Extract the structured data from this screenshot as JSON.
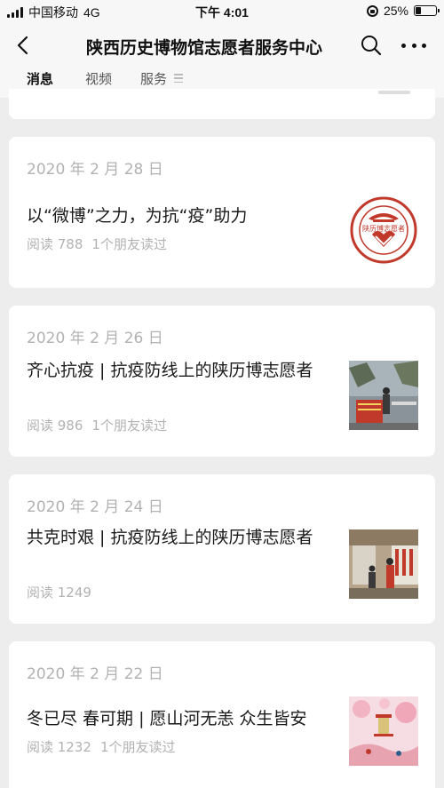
{
  "status_bar": {
    "carrier": "中国移动",
    "network": "4G",
    "time": "下午 4:01",
    "battery": "25%",
    "battery_level": 0.25
  },
  "nav": {
    "title": "陕西历史博物馆志愿者服务中心",
    "icons": [
      "back-icon",
      "search-icon",
      "more-icon"
    ]
  },
  "tabs": [
    {
      "label": "消息",
      "active": true
    },
    {
      "label": "视频",
      "active": false
    },
    {
      "label": "服务",
      "active": false
    }
  ],
  "colors": {
    "background": "#ededed",
    "card": "#ffffff",
    "muted_text": "#b2b2b2",
    "logo_red": "#c0392b"
  },
  "articles": [
    {
      "date": "2020 年 2 月 28 日",
      "title": "以“微博”之力，为抗“疫”助力",
      "reads": "阅读 788",
      "friends": "1个朋友读过",
      "thumbnail": "volunteer-logo",
      "logo_text": "陕历博志愿者",
      "logo_ring_text": "Shaanxi History Museum Volunteer"
    },
    {
      "date": "2020 年 2 月 26 日",
      "title": "齐心抗疫 | 抗疫防线上的陕历博志愿者",
      "reads": "阅读 986",
      "friends": "1个朋友读过",
      "thumbnail": "checkpoint-photo"
    },
    {
      "date": "2020 年 2 月 24 日",
      "title": "共克时艰 | 抗疫防线上的陕历博志愿者",
      "reads": "阅读 1249",
      "friends": "",
      "thumbnail": "gate-photo"
    },
    {
      "date": "2020 年 2 月 22 日",
      "title": "冬已尽 春可期 | 愿山河无恙 众生皆安",
      "reads": "阅读 1232",
      "friends": "1个朋友读过",
      "thumbnail": "pink-illustration"
    }
  ]
}
